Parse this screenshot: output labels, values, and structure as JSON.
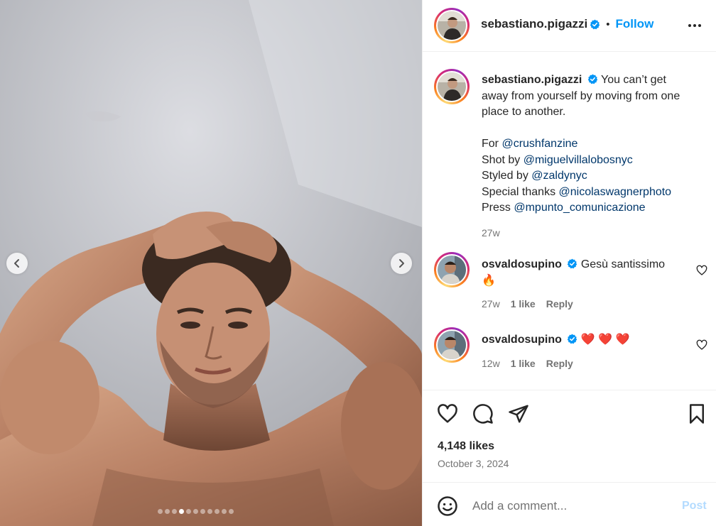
{
  "post": {
    "image_alt": "Shirtless man with hands on head against grey wall",
    "carousel_total": 11,
    "carousel_active": 3
  },
  "header": {
    "username": "sebastiano.pigazzi",
    "separator": "•",
    "follow_label": "Follow"
  },
  "caption": {
    "username": "sebastiano.pigazzi",
    "text": "You can’t get away from yourself by moving from one place to another.",
    "lines": [
      {
        "prefix": "For ",
        "mention": "@crushfanzine"
      },
      {
        "prefix": "Shot by ",
        "mention": "@miguelvillalobosnyc"
      },
      {
        "prefix": "Styled by ",
        "mention": "@zaldynyc"
      },
      {
        "prefix": "Special thanks ",
        "mention": "@nicolaswagnerphoto"
      },
      {
        "prefix": "Press ",
        "mention": "@mpunto_comunicazione"
      }
    ],
    "time": "27w"
  },
  "comments": [
    {
      "username": "osvaldosupino",
      "text": "Gesù santissimo",
      "emoji": "🔥",
      "time": "27w",
      "likes": "1 like",
      "reply": "Reply"
    },
    {
      "username": "osvaldosupino",
      "text": "",
      "emoji": "❤️ ❤️ ❤️",
      "time": "12w",
      "likes": "1 like",
      "reply": "Reply"
    }
  ],
  "stats": {
    "likes": "4,148 likes",
    "date": "October 3, 2024"
  },
  "composer": {
    "placeholder": "Add a comment...",
    "post_label": "Post"
  },
  "colors": {
    "accent": "#0095f6",
    "mention": "#00376b",
    "muted": "#737373",
    "post_disabled": "#b3dbff"
  }
}
